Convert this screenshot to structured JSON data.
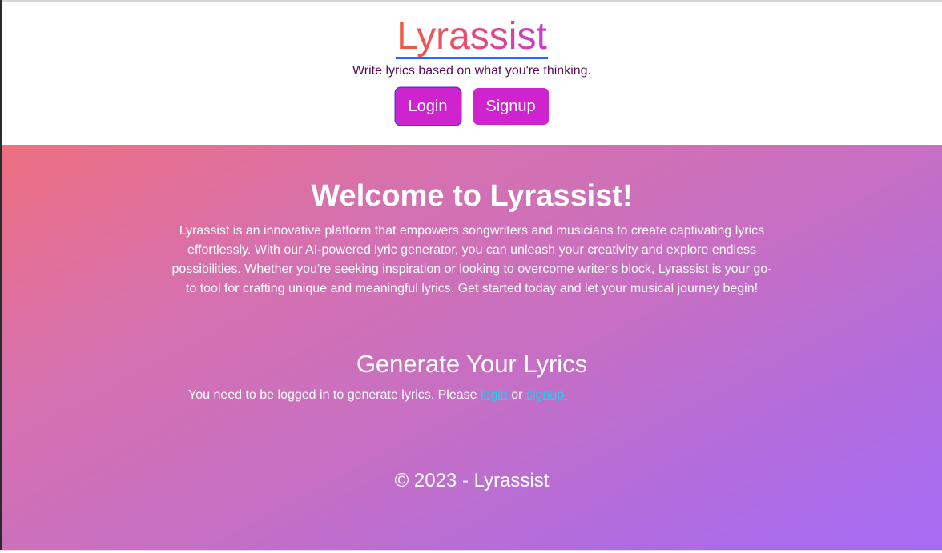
{
  "header": {
    "brand": "Lyrassist",
    "tagline": "Write lyrics based on what you're thinking.",
    "login_label": "Login",
    "signup_label": "Signup"
  },
  "main": {
    "welcome_title": "Welcome to Lyrassist!",
    "intro": "Lyrassist is an innovative platform that empowers songwriters and musicians to create captivating lyrics effortlessly. With our AI-powered lyric generator, you can unleash your creativity and explore endless possibilities. Whether you're seeking inspiration or looking to overcome writer's block, Lyrassist is your go-to tool for crafting unique and meaningful lyrics. Get started today and let your musical journey begin!",
    "generate_title": "Generate Your Lyrics",
    "notice_prefix": "You need to be logged in to generate lyrics. Please ",
    "notice_login_link": "login",
    "notice_or": " or ",
    "notice_signup_link": "signup."
  },
  "footer": {
    "copyright": "© 2023 - Lyrassist"
  },
  "colors": {
    "button_bg": "#cf23cf",
    "link": "#1ecff0",
    "tagline": "#5a0f52",
    "brand_underline": "#1f6fe8"
  }
}
